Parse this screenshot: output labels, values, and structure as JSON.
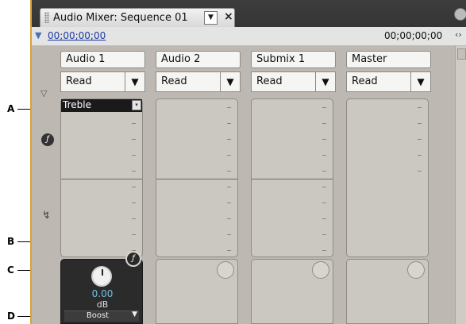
{
  "callouts": {
    "a": "A",
    "b": "B",
    "c": "C",
    "d": "D"
  },
  "tab": {
    "title": "Audio Mixer: Sequence 01",
    "menu_glyph": "▼",
    "close_glyph": "×"
  },
  "timecode": {
    "current": "00;00;00;00",
    "duration": "00;00;00;00",
    "expand_glyph": "‹›"
  },
  "channels": [
    {
      "name": "Audio 1",
      "mode": "Read",
      "mode_arrow": "▼"
    },
    {
      "name": "Audio 2",
      "mode": "Read",
      "mode_arrow": "▼"
    },
    {
      "name": "Submix 1",
      "mode": "Read",
      "mode_arrow": "▼"
    },
    {
      "name": "Master",
      "mode": "Read",
      "mode_arrow": "▼"
    }
  ],
  "effect": {
    "slot_label": "Treble",
    "slot_dropdown": "▾",
    "value": "0.00",
    "unit": "dB",
    "parameter": "Boost",
    "parameter_arrow": "▼"
  },
  "icons": {
    "fx_icon": "ƒ",
    "send_icon": "↯"
  },
  "colors": {
    "panel_accent": "#d8a23a",
    "timecode_link": "#1b3aa0",
    "effect_value": "#6ec2e6"
  }
}
